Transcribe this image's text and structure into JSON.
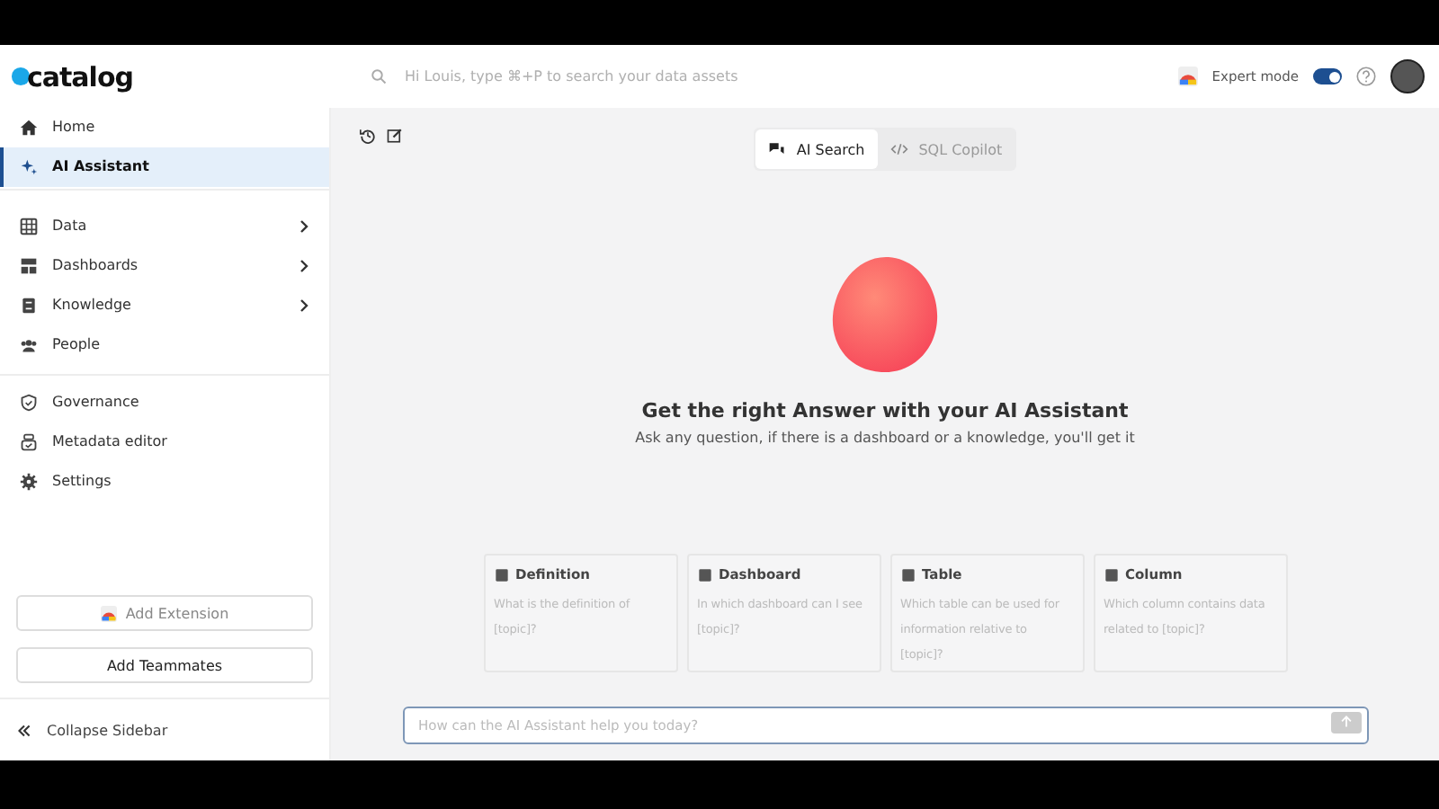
{
  "header": {
    "logo": "catalog",
    "search": {
      "placeholder": "Hi Louis, type ⌘+P to search your data assets"
    },
    "expert_mode": {
      "label": "Expert mode",
      "on": true
    }
  },
  "sidebar": {
    "groups": [
      [
        {
          "label": "Home",
          "selected": false,
          "expandable": false
        },
        {
          "label": "AI Assistant",
          "selected": true,
          "expandable": false
        }
      ],
      [
        {
          "label": "Data",
          "selected": false,
          "expandable": true
        },
        {
          "label": "Dashboards",
          "selected": false,
          "expandable": true
        },
        {
          "label": "Knowledge",
          "selected": false,
          "expandable": true
        },
        {
          "label": "People",
          "selected": false,
          "expandable": false
        }
      ],
      [
        {
          "label": "Governance",
          "selected": false,
          "expandable": false
        },
        {
          "label": "Metadata editor",
          "selected": false,
          "expandable": false
        },
        {
          "label": "Settings",
          "selected": false,
          "expandable": false
        }
      ]
    ],
    "buttons": [
      "Add Extension",
      "Add Teammates"
    ],
    "collapse": "Collapse Sidebar"
  },
  "main": {
    "modes": [
      {
        "label": "AI Search",
        "selected": true
      },
      {
        "label": "SQL Copilot",
        "selected": false
      }
    ],
    "heading": "Get the right Answer with your AI Assistant",
    "subtitle": "Ask any question, if there is a dashboard or a knowledge, you'll get it",
    "cards": [
      {
        "title": "Definition",
        "text": "What is the definition of [topic]?"
      },
      {
        "title": "Dashboard",
        "text": "In which dashboard can I see [topic]?"
      },
      {
        "title": "Table",
        "text": "Which table can be used for information relative to [topic]?"
      },
      {
        "title": "Column",
        "text": "Which column contains data related to [topic]?"
      }
    ],
    "prompt": {
      "placeholder": "How can the AI Assistant help you today?"
    }
  }
}
